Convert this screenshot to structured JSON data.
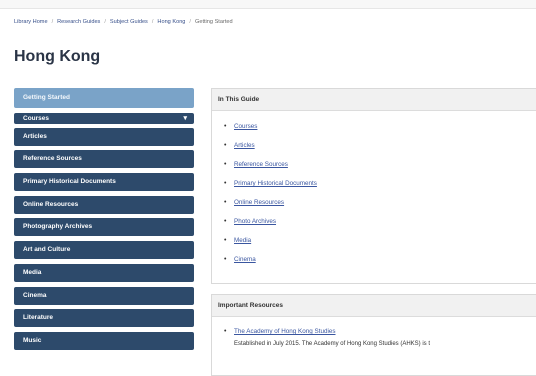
{
  "breadcrumb": {
    "items": [
      "Library Home",
      "Research Guides",
      "Subject Guides",
      "Hong Kong"
    ],
    "current": "Getting Started"
  },
  "page": {
    "title": "Hong Kong"
  },
  "sidebar": {
    "items": [
      {
        "label": "Getting Started",
        "active": true
      },
      {
        "label": "Courses",
        "dropdown": true
      },
      {
        "label": "Articles"
      },
      {
        "label": "Reference Sources"
      },
      {
        "label": "Primary Historical Documents"
      },
      {
        "label": "Online Resources"
      },
      {
        "label": "Photography Archives"
      },
      {
        "label": "Art and Culture"
      },
      {
        "label": "Media"
      },
      {
        "label": "Cinema"
      },
      {
        "label": "Literature"
      },
      {
        "label": "Music"
      }
    ]
  },
  "in_this_guide": {
    "heading": "In This Guide",
    "links": [
      "Courses",
      "Articles",
      "Reference Sources",
      "Primary Historical Documents",
      "Online Resources",
      "Photo Archives",
      "Media",
      "Cinema"
    ]
  },
  "important_resources": {
    "heading": "Important Resources",
    "items": [
      {
        "label": "The Academy of Hong Kong Studies",
        "description": "Established in July 2015. The Academy of Hong Kong Studies (AHKS) is t"
      }
    ]
  },
  "colors": {
    "nav_bg": "#2d4a6b",
    "nav_active_bg": "#7aa3c8",
    "link": "#3a56a0",
    "title": "#2a3446"
  }
}
